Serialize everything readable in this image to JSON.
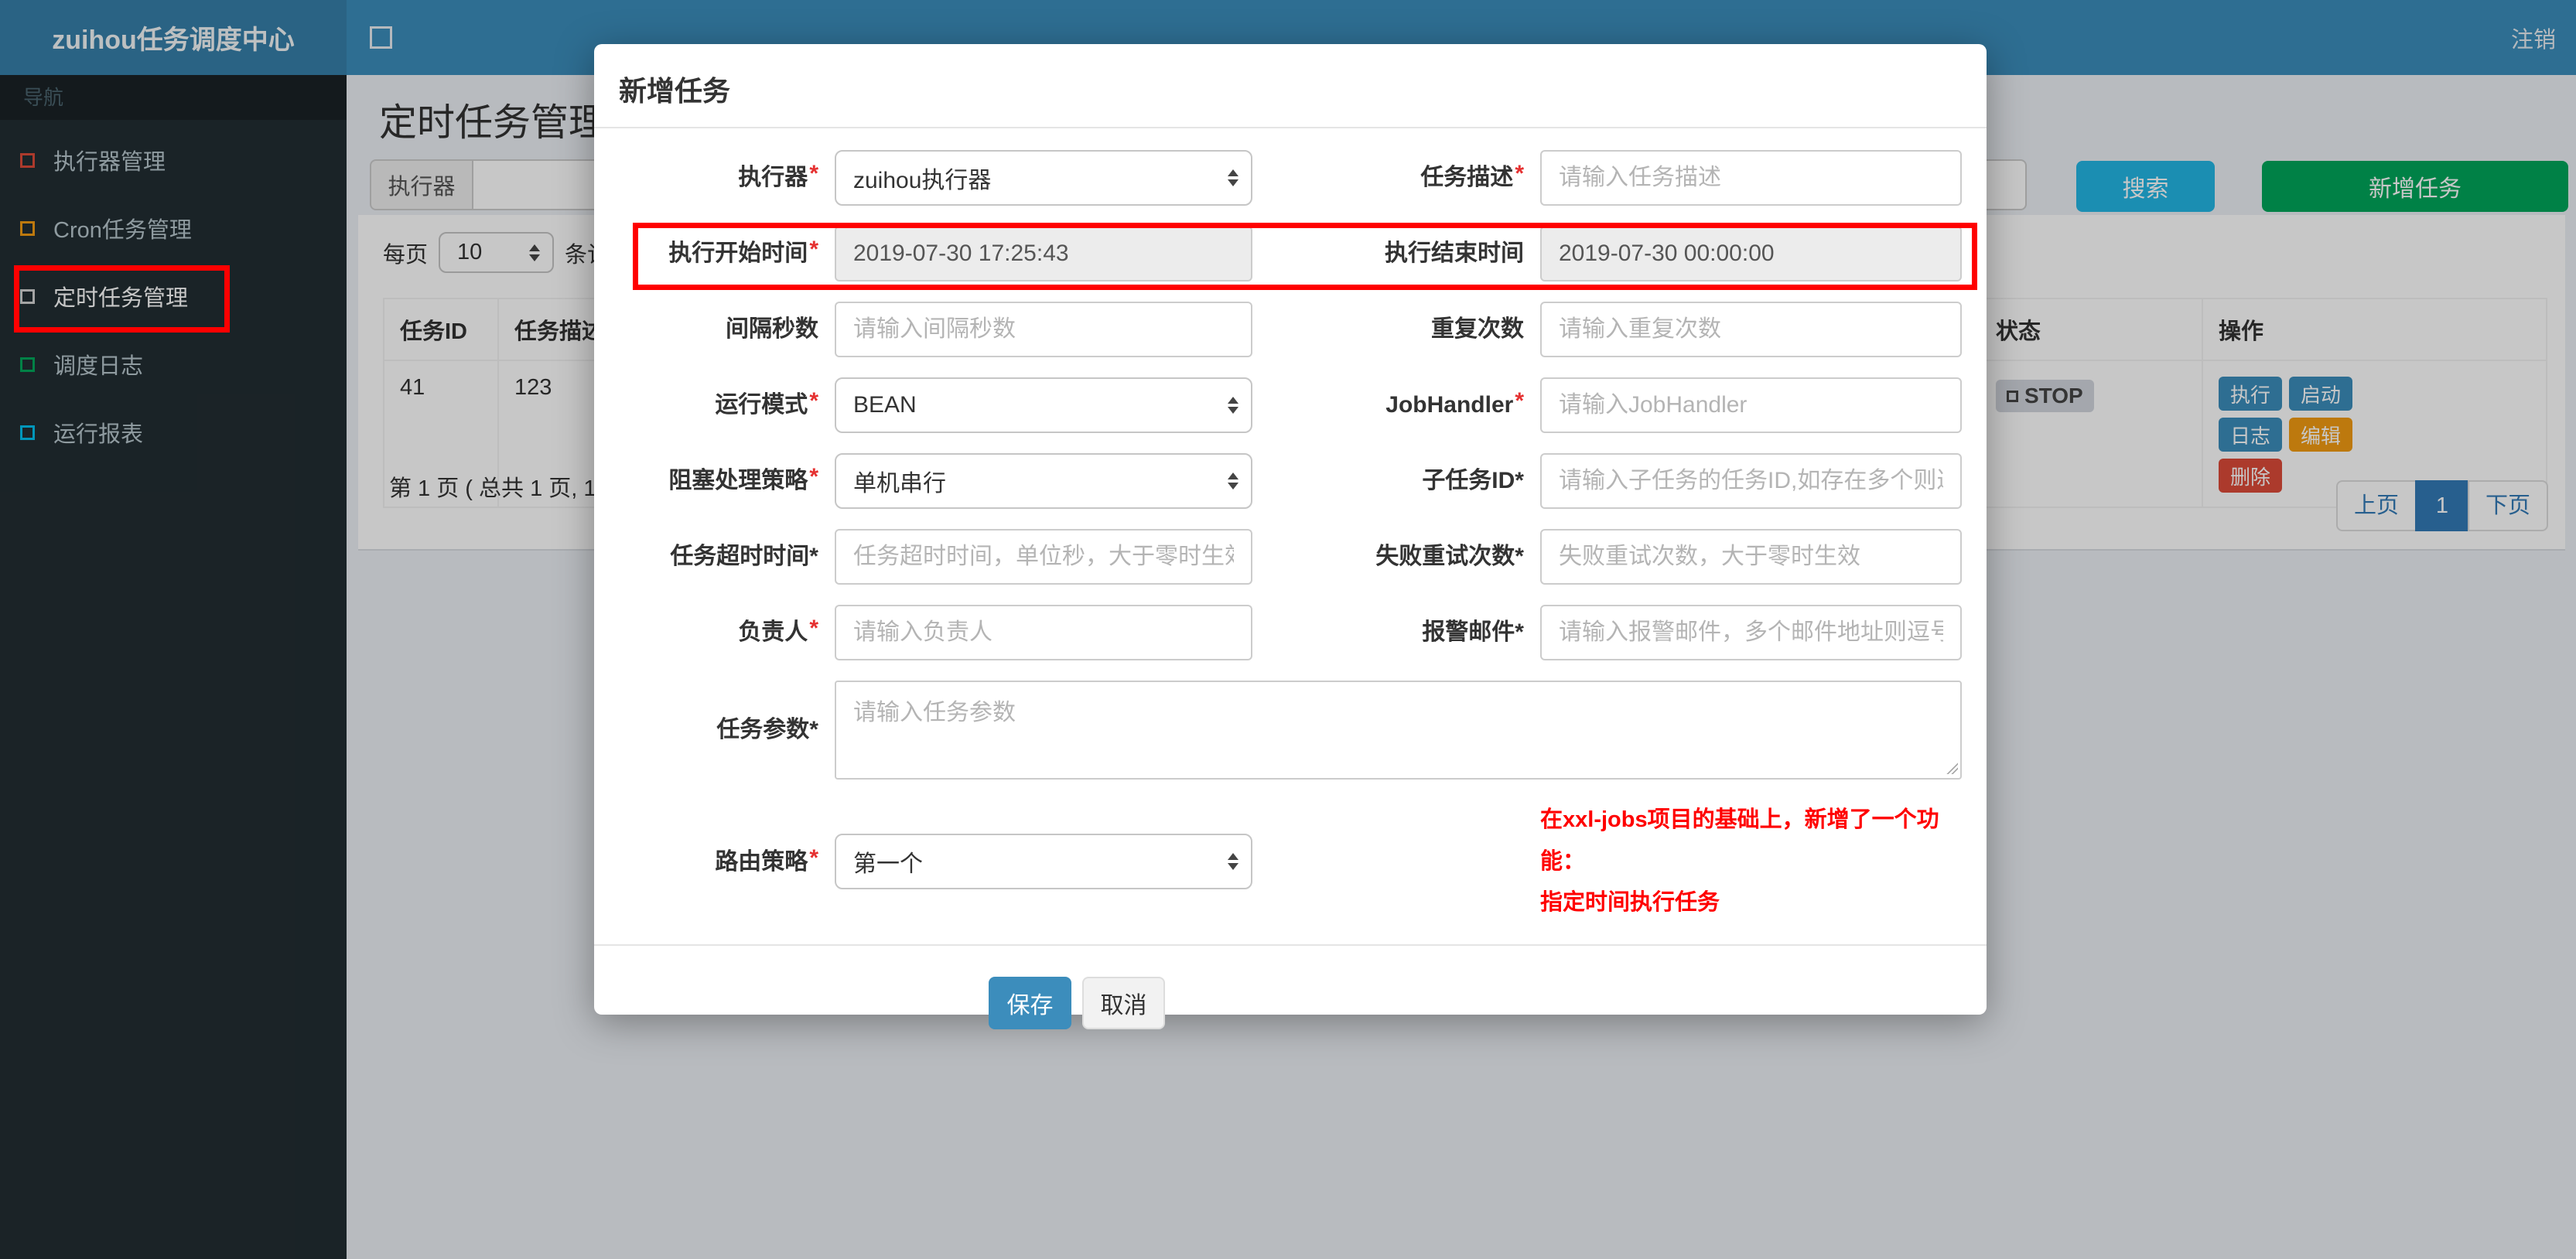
{
  "app": {
    "brand": "zuihou任务调度中心",
    "logout_label": "注销"
  },
  "icons": {
    "navbar_toggle": "box-glyph",
    "sidebar_item": "box-glyph",
    "status_stop": "box-glyph",
    "select_caret": "up-down-arrows"
  },
  "annotation_color": "#ff0000",
  "sidebar": {
    "section_label": "导航",
    "items": [
      {
        "label": "执行器管理",
        "color": "#dd4b39",
        "active": false
      },
      {
        "label": "Cron任务管理",
        "color": "#f39c12",
        "active": false
      },
      {
        "label": "定时任务管理",
        "color": "#d2d2d2",
        "active": true
      },
      {
        "label": "调度日志",
        "color": "#00a65a",
        "active": false
      },
      {
        "label": "运行报表",
        "color": "#00c0ef",
        "active": false
      }
    ]
  },
  "page": {
    "title": "定时任务管理"
  },
  "filter": {
    "executor_addon_label": "执行器",
    "search_button": "搜索",
    "add_button": "新增任务"
  },
  "table": {
    "page_size_prefix": "每页",
    "page_size_value": "10",
    "page_size_suffix": "条记录",
    "columns": [
      "任务ID",
      "任务描述",
      "状态",
      "操作"
    ],
    "row": {
      "id": "41",
      "desc": "123",
      "status": "STOP",
      "actions": [
        "执行",
        "启动",
        "日志",
        "编辑",
        "删除"
      ]
    },
    "info": "第 1 页 ( 总共 1 页, 1",
    "pagination": {
      "prev": "上页",
      "current": "1",
      "next": "下页"
    }
  },
  "modal": {
    "title": "新增任务",
    "required_marker": "*",
    "fields": {
      "executor": {
        "label": "执行器",
        "value": "zuihou执行器"
      },
      "job_desc": {
        "label": "任务描述",
        "placeholder": "请输入任务描述"
      },
      "start_time": {
        "label": "执行开始时间",
        "value": "2019-07-30 17:25:43"
      },
      "end_time": {
        "label": "执行结束时间",
        "value": "2019-07-30 00:00:00"
      },
      "interval_seconds": {
        "label": "间隔秒数",
        "placeholder": "请输入间隔秒数"
      },
      "repeat_count": {
        "label": "重复次数",
        "placeholder": "请输入重复次数"
      },
      "run_mode": {
        "label": "运行模式",
        "value": "BEAN"
      },
      "job_handler": {
        "label": "JobHandler",
        "placeholder": "请输入JobHandler"
      },
      "block_strategy": {
        "label": "阻塞处理策略",
        "value": "单机串行"
      },
      "child_job_id": {
        "label": "子任务ID*",
        "placeholder": "请输入子任务的任务ID,如存在多个则逗号分隔"
      },
      "timeout": {
        "label": "任务超时时间*",
        "placeholder": "任务超时时间，单位秒，大于零时生效"
      },
      "fail_retry": {
        "label": "失败重试次数*",
        "placeholder": "失败重试次数，大于零时生效"
      },
      "owner": {
        "label": "负责人",
        "placeholder": "请输入负责人"
      },
      "alarm_email": {
        "label": "报警邮件*",
        "placeholder": "请输入报警邮件，多个邮件地址则逗号分隔"
      },
      "job_params": {
        "label": "任务参数*",
        "placeholder": "请输入任务参数"
      },
      "route_strategy": {
        "label": "路由策略",
        "value": "第一个"
      }
    },
    "note_line1": "在xxl-jobs项目的基础上，新增了一个功能：",
    "note_line2": "指定时间执行任务",
    "save_label": "保存",
    "cancel_label": "取消"
  }
}
